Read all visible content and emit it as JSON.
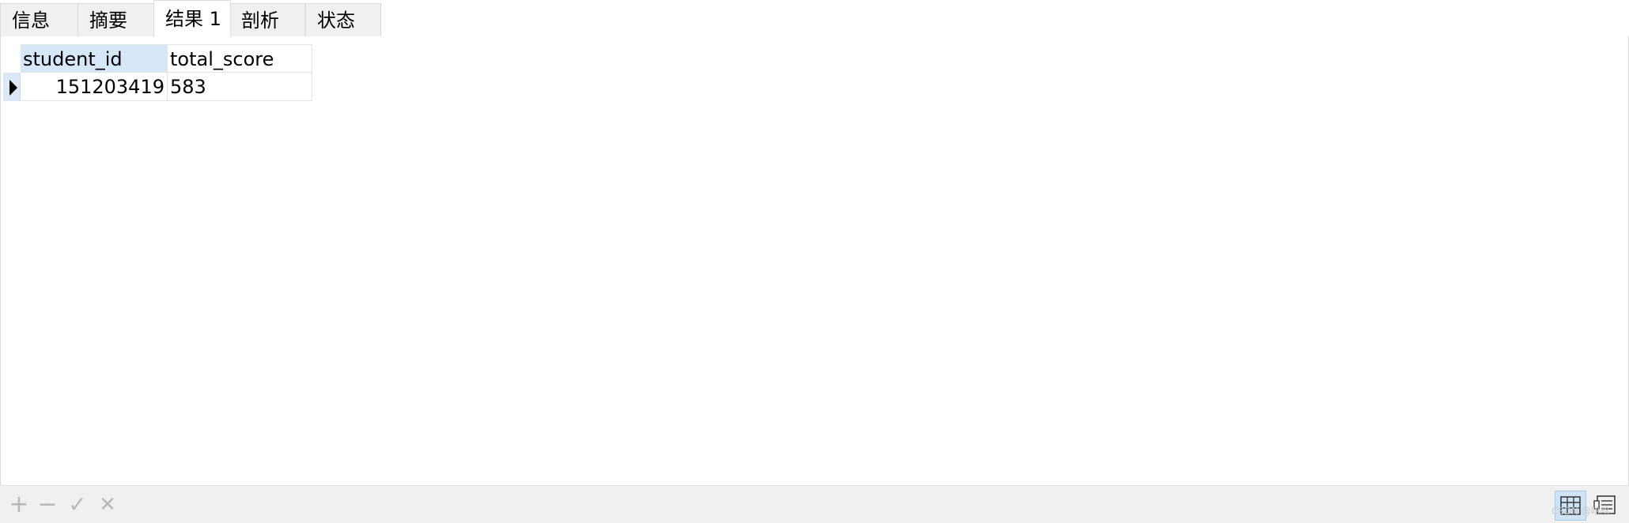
{
  "tabs": [
    {
      "label": "信息"
    },
    {
      "label": "摘要"
    },
    {
      "label": "结果 1"
    },
    {
      "label": "剖析"
    },
    {
      "label": "状态"
    }
  ],
  "grid": {
    "columns": [
      "student_id",
      "total_score"
    ],
    "rows": [
      [
        "151203419",
        "583"
      ]
    ]
  },
  "toolbar": {
    "add_icon": "+",
    "remove_icon": "−",
    "apply_icon": "✓",
    "discard_icon": "✕"
  },
  "watermark": "CSDN @哈哈"
}
